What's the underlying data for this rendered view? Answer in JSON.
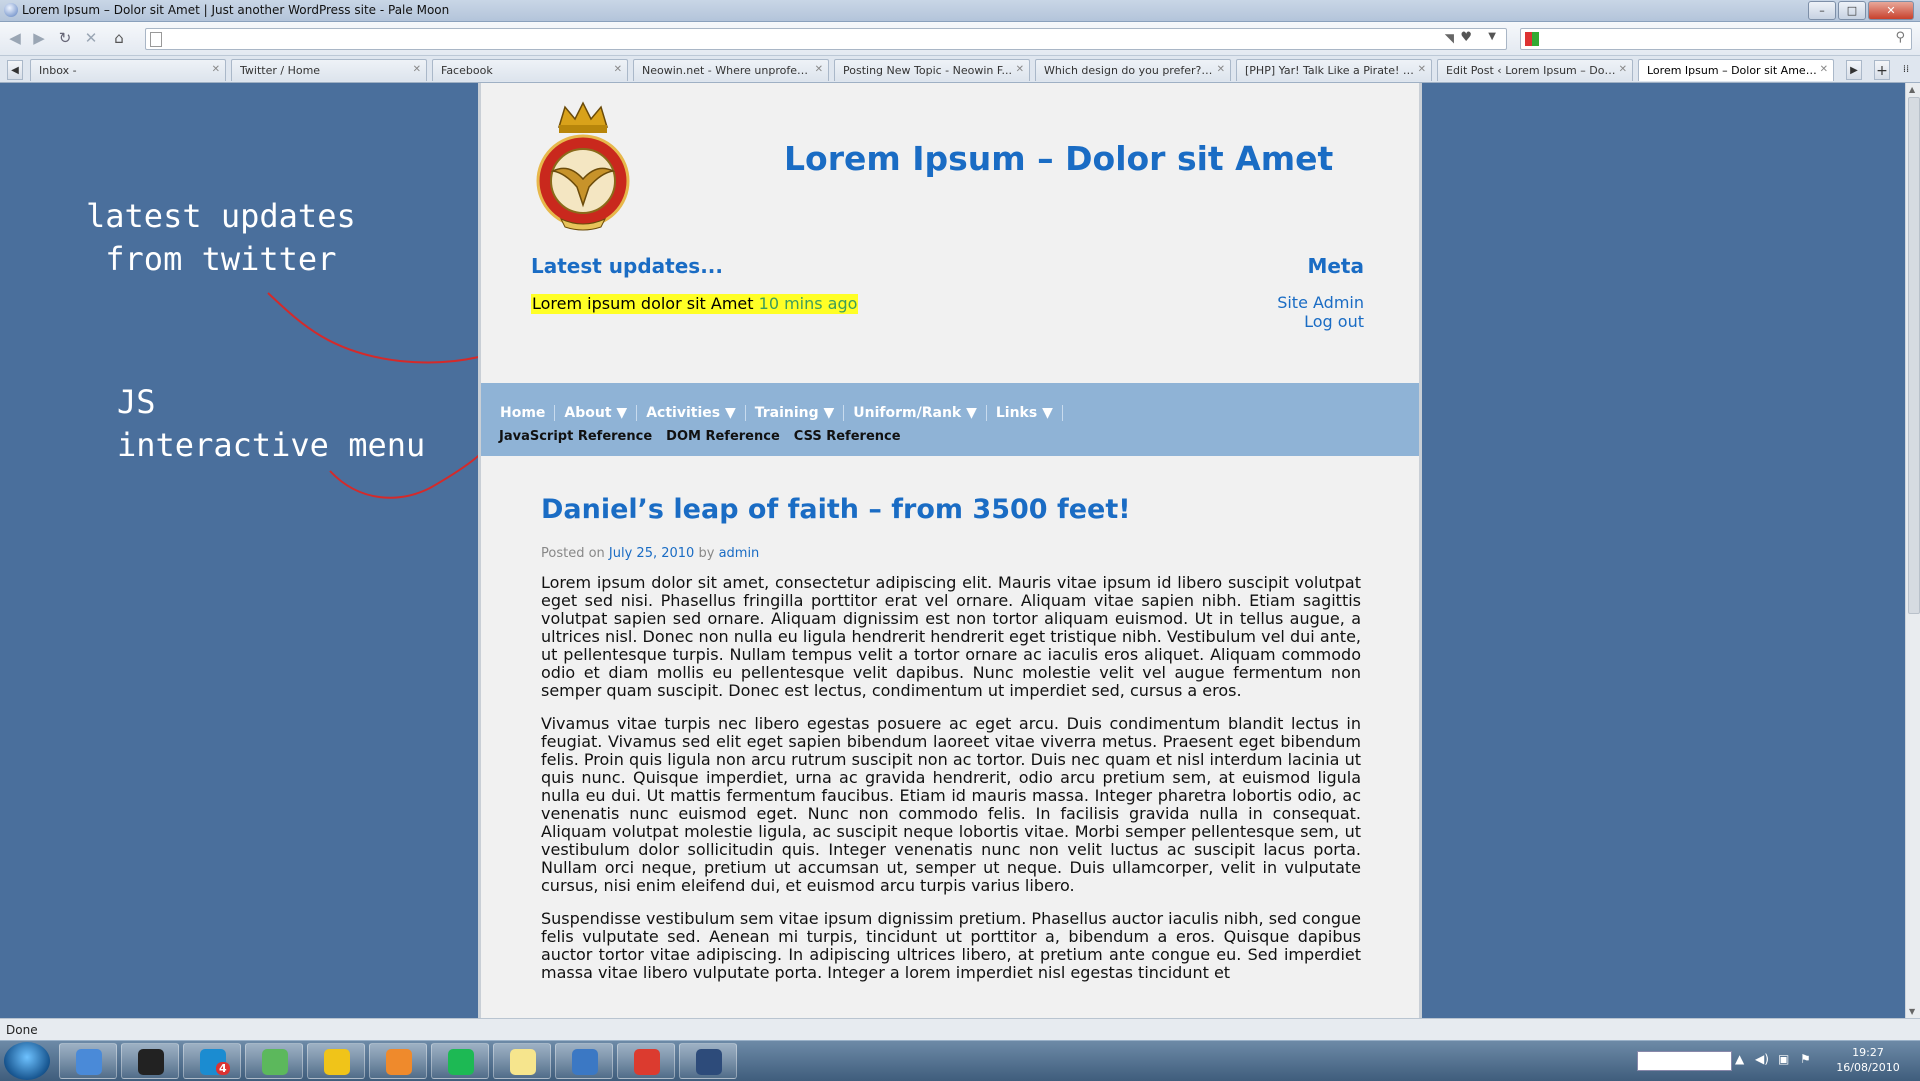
{
  "window": {
    "title": "Lorem Ipsum – Dolor sit Amet | Just another WordPress site - Pale Moon",
    "minimize": "–",
    "maximize": "□",
    "close": "✕"
  },
  "nav": {
    "back": "◀",
    "forward": "▶",
    "reload": "↻",
    "stop": "✕",
    "home": "⌂",
    "url": "",
    "search_value": "",
    "icons": [
      "back-icon",
      "forward-icon",
      "reload-icon",
      "stop-icon",
      "home-icon",
      "page-icon",
      "rss-icon",
      "bookmark-heart-icon",
      "search-engine-icon",
      "search-icon"
    ]
  },
  "tabs": [
    {
      "label": "Inbox -",
      "active": false
    },
    {
      "label": "Twitter / Home",
      "active": false
    },
    {
      "label": "Facebook",
      "active": false
    },
    {
      "label": "Neowin.net - Where unprofess...",
      "active": false
    },
    {
      "label": "Posting New Topic - Neowin F...",
      "active": false
    },
    {
      "label": "Which design do you prefer? L...",
      "active": false
    },
    {
      "label": "[PHP] Yar! Talk Like a Pirate! - ...",
      "active": false
    },
    {
      "label": "Edit Post ‹ Lorem Ipsum – Dolo...",
      "active": false
    },
    {
      "label": "Lorem Ipsum – Dolor sit Amet |...",
      "active": true
    }
  ],
  "annotations": {
    "twitter": "latest updates\n from twitter",
    "menu": "JS\ninteractive menu",
    "arrow_color": "#d42a2a"
  },
  "site": {
    "title": "Lorem Ipsum – Dolor sit Amet",
    "latest_heading": "Latest updates...",
    "tweet_text": "Lorem ipsum dolor sit Amet",
    "tweet_time": "10 mins ago",
    "meta_heading": "Meta",
    "meta_links": [
      "Site Admin",
      "Log out"
    ],
    "menu": [
      "Home",
      "About ▼",
      "Activities ▼",
      "Training ▼",
      "Uniform/Rank ▼",
      "Links ▼"
    ],
    "submenu": [
      "JavaScript Reference",
      "DOM Reference",
      "CSS Reference"
    ],
    "colors": {
      "link": "#1a6cc4",
      "menu_bg": "#8fb3d6",
      "page_bg": "#4a6f9c",
      "highlight": "#ffff26"
    }
  },
  "post": {
    "title": "Daniel’s leap of faith – from 3500 feet!",
    "posted_on": "Posted on",
    "date": "July 25, 2010",
    "by": "by",
    "author": "admin",
    "paragraphs": [
      "Lorem ipsum dolor sit amet, consectetur adipiscing elit. Mauris vitae ipsum id libero suscipit volutpat eget sed nisi. Phasellus fringilla porttitor erat vel ornare. Aliquam vitae sapien nibh. Etiam sagittis volutpat sapien sed ornare. Aliquam dignissim est non tortor aliquam euismod. Ut in tellus augue, a ultrices nisl. Donec non nulla eu ligula hendrerit hendrerit eget tristique nibh. Vestibulum vel dui ante, ut pellentesque turpis. Nullam tempus velit a tortor ornare ac iaculis eros aliquet. Aliquam commodo odio et diam mollis eu pellentesque velit dapibus. Nunc molestie velit vel augue fermentum non semper quam suscipit. Donec est lectus, condimentum ut imperdiet sed, cursus a eros.",
      "Vivamus vitae turpis nec libero egestas posuere ac eget arcu. Duis condimentum blandit lectus in feugiat. Vivamus sed elit eget sapien bibendum laoreet vitae viverra metus. Praesent eget bibendum felis. Proin quis ligula non arcu rutrum suscipit non ac tortor. Duis nec quam et nisl interdum lacinia ut quis nunc. Quisque imperdiet, urna ac gravida hendrerit, odio arcu pretium sem, at euismod ligula nulla eu dui. Ut mattis fermentum faucibus. Etiam id mauris massa. Integer pharetra lobortis odio, ac venenatis nunc euismod eget. Nunc non commodo felis. In facilisis gravida nulla in consequat. Aliquam volutpat molestie ligula, ac suscipit neque lobortis vitae. Morbi semper pellentesque sem, ut vestibulum dolor sollicitudin quis. Integer venenatis nunc non velit luctus ac suscipit lacus porta. Nullam orci neque, pretium ut accumsan ut, semper ut neque. Duis ullamcorper, velit in vulputate cursus, nisi enim eleifend dui, et euismod arcu turpis varius libero.",
      "Suspendisse vestibulum sem vitae ipsum dignissim pretium. Phasellus auctor iaculis nibh, sed congue felis vulputate sed. Aenean mi turpis, tincidunt ut porttitor a, bibendum a eros. Quisque dapibus auctor tortor vitae adipiscing. In adipiscing ultrices libero, at pretium ante congue eu. Sed imperdiet massa vitae libero vulputate porta. Integer a lorem imperdiet nisl egestas tincidunt et"
    ]
  },
  "status": {
    "text": "Done"
  },
  "taskbar": {
    "apps": [
      "firefox-icon",
      "steam-icon",
      "tweetdeck-icon",
      "messenger-icon",
      "ie-tester-icon",
      "media-player-icon",
      "spotify-icon",
      "sticky-notes-icon",
      "paint-icon",
      "chrome-icon",
      "pale-moon-icon"
    ],
    "tweetdeck_badge": "4",
    "tray_icons": [
      "show-hidden-icon",
      "volume-icon",
      "network-icon",
      "action-center-icon"
    ],
    "time": "19:27",
    "date": "16/08/2010"
  }
}
